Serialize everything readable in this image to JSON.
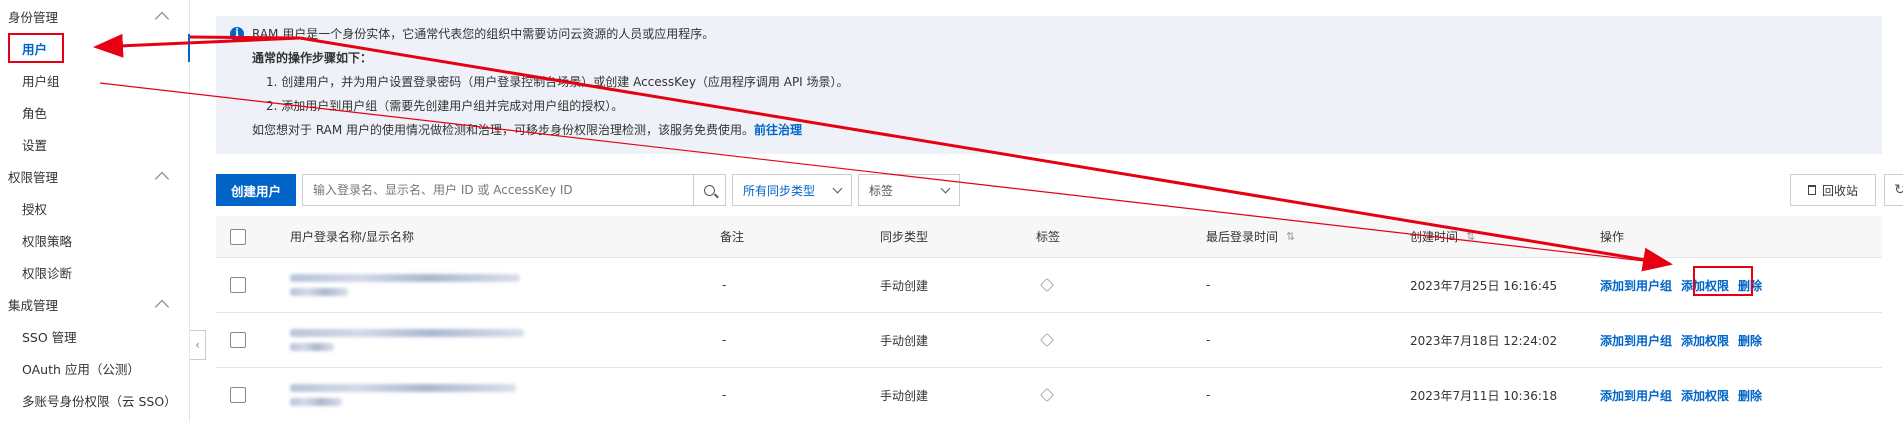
{
  "sidebar": {
    "groups": [
      {
        "title": "身份管理",
        "items": [
          "用户",
          "用户组",
          "角色",
          "设置"
        ]
      },
      {
        "title": "权限管理",
        "items": [
          "授权",
          "权限策略",
          "权限诊断"
        ]
      },
      {
        "title": "集成管理",
        "items": [
          "SSO 管理",
          "OAuth 应用（公测）",
          "多账号身份权限（云 SSO）"
        ]
      }
    ],
    "active_item": "用户"
  },
  "info": {
    "intro": "RAM 用户是一个身份实体，它通常代表您的组织中需要访问云资源的人员或应用程序。",
    "steps_title": "通常的操作步骤如下：",
    "step1": "1. 创建用户，并为用户设置登录密码（用户登录控制台场景）或创建 AccessKey（应用程序调用 API 场景）。",
    "step2": "2. 添加用户到用户组（需要先创建用户组并完成对用户组的授权）。",
    "governance": "如您想对于 RAM 用户的使用情况做检测和治理，可移步身份权限治理检测，该服务免费使用。",
    "governance_link": "前往治理"
  },
  "toolbar": {
    "create_user": "创建用户",
    "search_placeholder": "输入登录名、显示名、用户 ID 或 AccessKey ID",
    "sync_type": "所有同步类型",
    "tags": "标签",
    "recycle_bin": "回收站"
  },
  "table": {
    "headers": {
      "name": "用户登录名称/显示名称",
      "note": "备注",
      "sync": "同步类型",
      "tag": "标签",
      "last_login": "最后登录时间",
      "created": "创建时间",
      "ops": "操作"
    },
    "rows": [
      {
        "note": "-",
        "sync": "手动创建",
        "last_login": "-",
        "created": "2023年7月25日 16:16:45"
      },
      {
        "note": "-",
        "sync": "手动创建",
        "last_login": "-",
        "created": "2023年7月18日 12:24:02"
      },
      {
        "note": "-",
        "sync": "手动创建",
        "last_login": "-",
        "created": "2023年7月11日 10:36:18"
      }
    ],
    "ops": {
      "add_to_group": "添加到用户组",
      "add_permission": "添加权限",
      "delete": "删除"
    }
  },
  "colors": {
    "accent": "#0064c8",
    "annotation": "#e60012",
    "info_bg": "#eef2f8"
  }
}
